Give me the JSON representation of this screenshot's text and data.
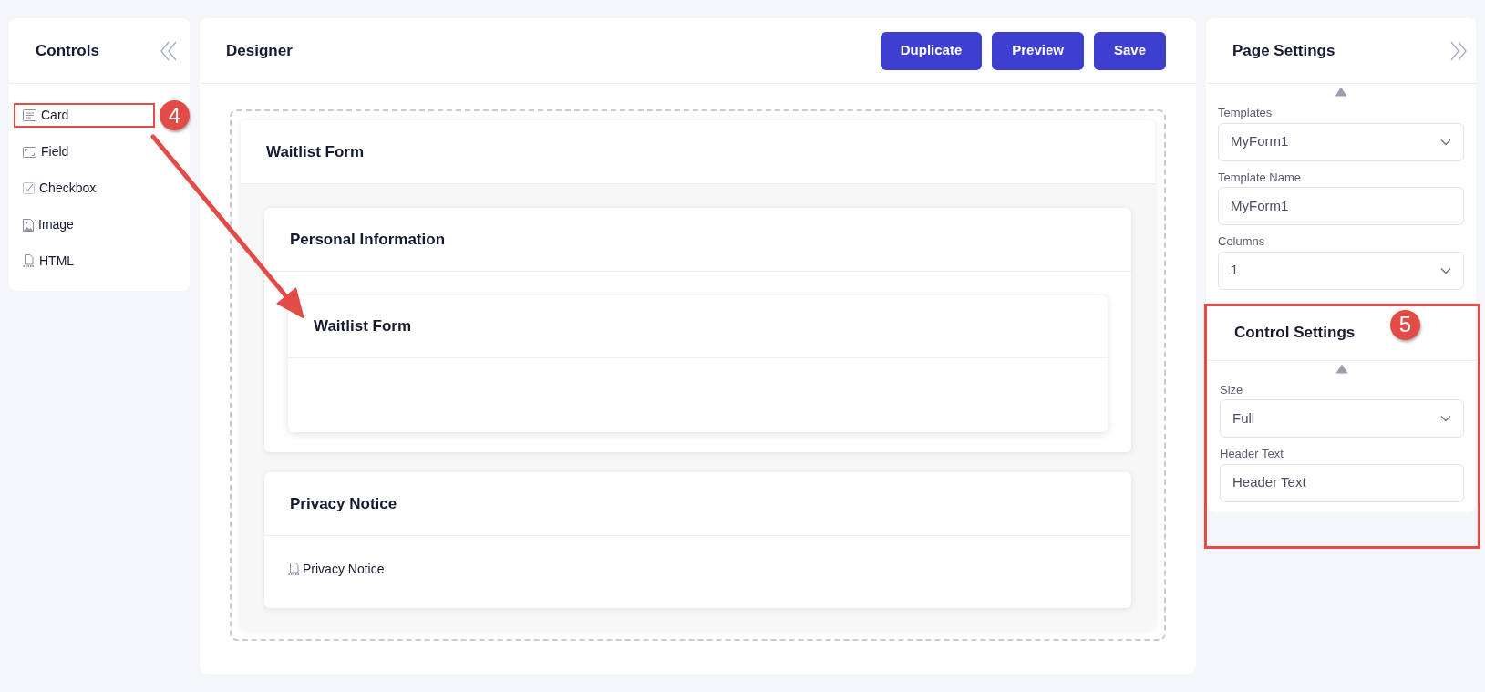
{
  "controls": {
    "title": "Controls",
    "items": [
      {
        "label": "Card",
        "kind": "card",
        "highlighted": true,
        "badge": "4"
      },
      {
        "label": "Field",
        "kind": "field",
        "highlighted": false
      },
      {
        "label": "Checkbox",
        "kind": "checkbox",
        "highlighted": false
      },
      {
        "label": "Image",
        "kind": "image",
        "highlighted": false
      },
      {
        "label": "HTML",
        "kind": "html",
        "highlighted": false
      }
    ]
  },
  "designer": {
    "title": "Designer",
    "buttons": [
      "Duplicate",
      "Preview",
      "Save"
    ],
    "form": {
      "title": "Waitlist Form",
      "sections": [
        {
          "title": "Personal Information",
          "content": [
            {
              "kind": "card",
              "title": "Waitlist Form"
            }
          ]
        },
        {
          "title": "Privacy Notice",
          "content": [
            {
              "kind": "html",
              "label": "Privacy Notice"
            }
          ]
        }
      ]
    }
  },
  "page_settings": {
    "title": "Page Settings",
    "fields": [
      {
        "label": "Templates",
        "kind": "select",
        "value": "MyForm1"
      },
      {
        "label": "Template Name",
        "kind": "text",
        "value": "MyForm1"
      },
      {
        "label": "Columns",
        "kind": "select",
        "value": "1"
      }
    ]
  },
  "control_settings": {
    "title": "Control Settings",
    "highlighted": true,
    "badge": "5",
    "fields": [
      {
        "label": "Size",
        "kind": "select",
        "value": "Full"
      },
      {
        "label": "Header Text",
        "kind": "text",
        "value": "Header Text"
      }
    ]
  }
}
